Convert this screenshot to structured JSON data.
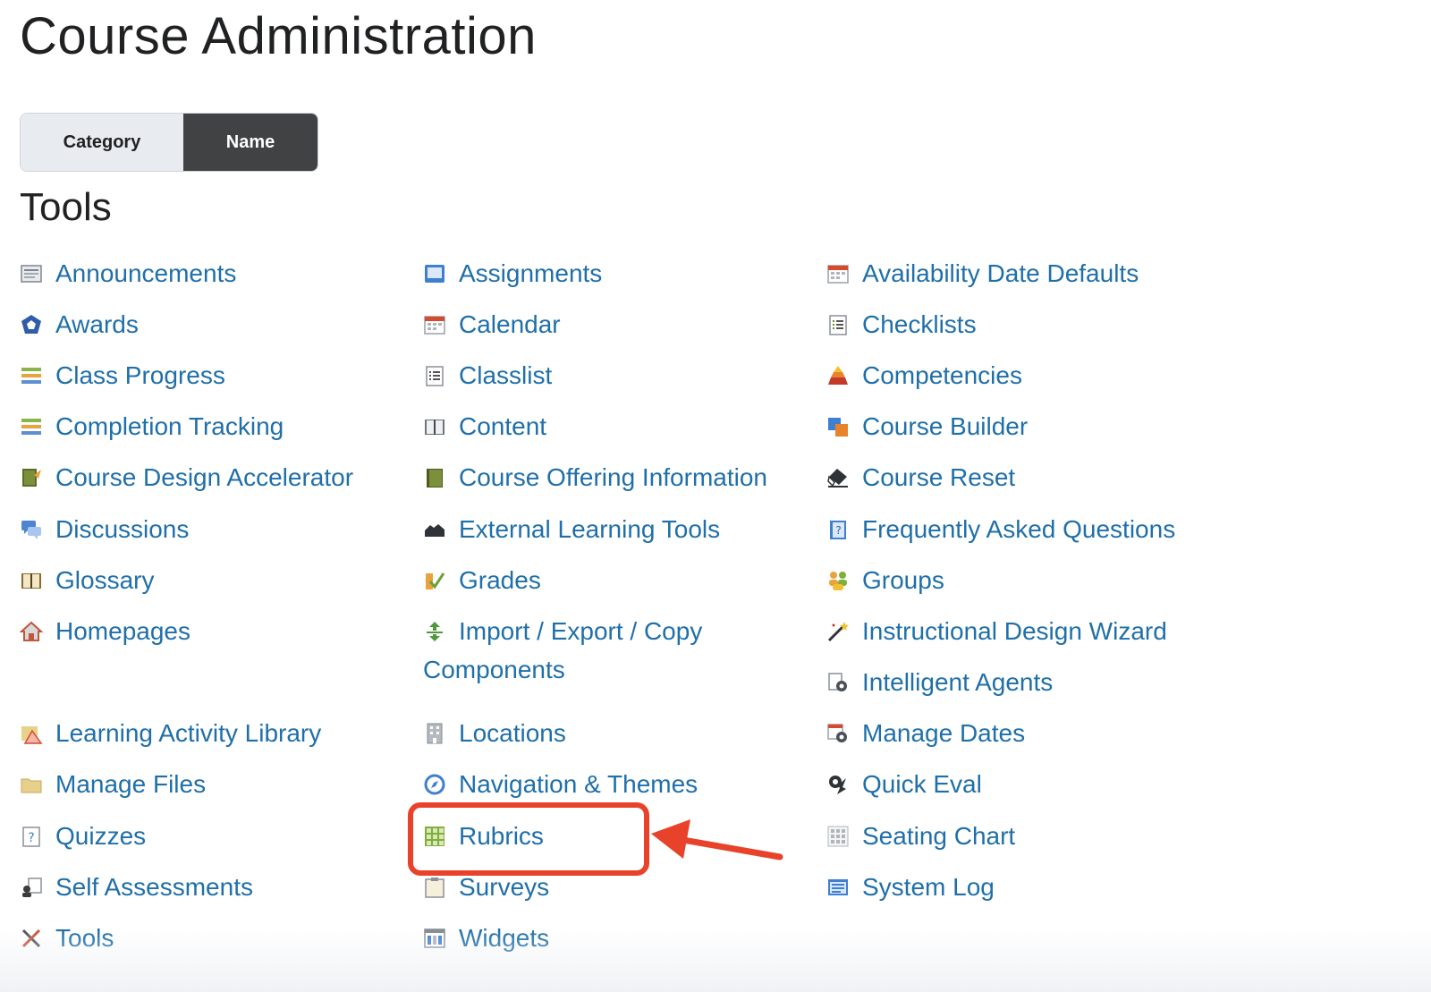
{
  "page": {
    "title": "Course Administration"
  },
  "view_toggle": {
    "category_label": "Category",
    "name_label": "Name",
    "selected": "Name"
  },
  "section": {
    "title": "Tools"
  },
  "colors": {
    "link": "#1f6fa9",
    "annotation": "#e8432a",
    "toggle_active": "#414244",
    "toggle_inactive": "#e8ecf0"
  },
  "tools": {
    "col1": [
      {
        "label": "Announcements",
        "icon": "announcements-icon"
      },
      {
        "label": "Awards",
        "icon": "awards-icon"
      },
      {
        "label": "Class Progress",
        "icon": "class-progress-icon"
      },
      {
        "label": "Completion Tracking",
        "icon": "completion-tracking-icon"
      },
      {
        "label": "Course Design Accelerator",
        "icon": "course-design-accelerator-icon"
      },
      {
        "label": "Discussions",
        "icon": "discussions-icon"
      },
      {
        "label": "Glossary",
        "icon": "glossary-icon"
      },
      {
        "label": "Homepages",
        "icon": "homepages-icon"
      },
      {
        "label": "Learning Activity Library",
        "icon": "learning-activity-library-icon"
      },
      {
        "label": "Manage Files",
        "icon": "manage-files-icon"
      },
      {
        "label": "Quizzes",
        "icon": "quizzes-icon"
      },
      {
        "label": "Self Assessments",
        "icon": "self-assessments-icon"
      },
      {
        "label": "Tools",
        "icon": "tools-icon"
      }
    ],
    "col2": [
      {
        "label": "Assignments",
        "icon": "assignments-icon"
      },
      {
        "label": "Calendar",
        "icon": "calendar-icon"
      },
      {
        "label": "Classlist",
        "icon": "classlist-icon"
      },
      {
        "label": "Content",
        "icon": "content-icon"
      },
      {
        "label": "Course Offering Information",
        "icon": "course-offering-information-icon"
      },
      {
        "label": "External Learning Tools",
        "icon": "external-learning-tools-icon"
      },
      {
        "label": "Grades",
        "icon": "grades-icon"
      },
      {
        "label": "Import / Export / Copy Components",
        "icon": "import-export-copy-icon"
      },
      {
        "label": "Locations",
        "icon": "locations-icon"
      },
      {
        "label": "Navigation & Themes",
        "icon": "navigation-themes-icon"
      },
      {
        "label": "Rubrics",
        "icon": "rubrics-icon"
      },
      {
        "label": "Surveys",
        "icon": "surveys-icon"
      },
      {
        "label": "Widgets",
        "icon": "widgets-icon"
      }
    ],
    "col3": [
      {
        "label": "Availability Date Defaults",
        "icon": "availability-date-defaults-icon"
      },
      {
        "label": "Checklists",
        "icon": "checklists-icon"
      },
      {
        "label": "Competencies",
        "icon": "competencies-icon"
      },
      {
        "label": "Course Builder",
        "icon": "course-builder-icon"
      },
      {
        "label": "Course Reset",
        "icon": "course-reset-icon"
      },
      {
        "label": "Frequently Asked Questions",
        "icon": "faq-icon"
      },
      {
        "label": "Groups",
        "icon": "groups-icon"
      },
      {
        "label": "Instructional Design Wizard",
        "icon": "instructional-design-wizard-icon"
      },
      {
        "label": "Intelligent Agents",
        "icon": "intelligent-agents-icon"
      },
      {
        "label": "Manage Dates",
        "icon": "manage-dates-icon"
      },
      {
        "label": "Quick Eval",
        "icon": "quick-eval-icon"
      },
      {
        "label": "Seating Chart",
        "icon": "seating-chart-icon"
      },
      {
        "label": "System Log",
        "icon": "system-log-icon"
      }
    ]
  }
}
